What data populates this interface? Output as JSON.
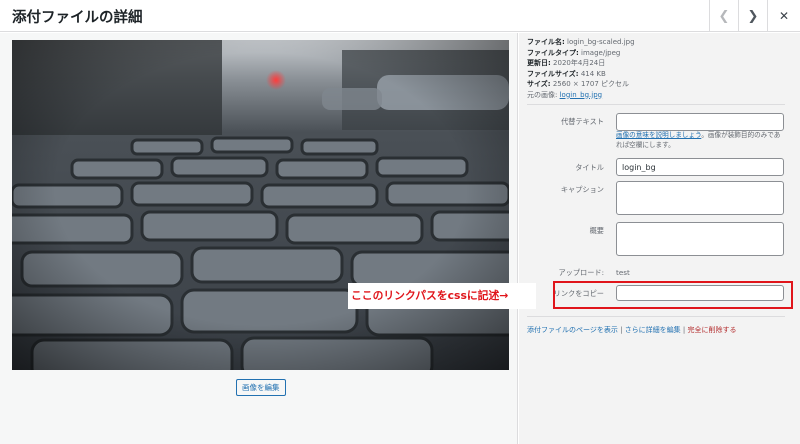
{
  "header": {
    "title": "添付ファイルの詳細",
    "prev_icon": "chevron-left",
    "next_icon": "chevron-right",
    "close_icon": "close"
  },
  "details": {
    "file_name_label": "ファイル名:",
    "file_name": "login_bg-scaled.jpg",
    "file_type_label": "ファイルタイプ:",
    "file_type": "image/jpeg",
    "updated_label": "更新日:",
    "updated": "2020年4月24日",
    "file_size_label": "ファイルサイズ:",
    "file_size": "414 KB",
    "dimensions_label": "サイズ:",
    "dimensions": "2560 × 1707 ピクセル",
    "original_label": "元の画像:",
    "original_link": "login_bg.jpg"
  },
  "fields": {
    "alt_label": "代替テキスト",
    "alt_value": "",
    "alt_help_link": "画像の意味を説明しましょう",
    "alt_help_text": "。画像が装飾目的のみであれば空欄にします。",
    "title_label": "タイトル",
    "title_value": "login_bg",
    "caption_label": "キャプション",
    "caption_value": "",
    "description_label": "概要",
    "description_value": "",
    "uploaded_by_label": "アップロード:",
    "uploaded_by": "test",
    "copy_link_label": "リンクをコピー",
    "copy_link_value": ""
  },
  "annotation": {
    "text": "ここのリンクパスをcssに記述→",
    "color": "#e0151b"
  },
  "actions": {
    "view_page": "添付ファイルのページを表示",
    "edit_more": "さらに詳細を編集",
    "delete": "完全に削除する",
    "separator": " | "
  },
  "edit_image_button": "画像を編集"
}
